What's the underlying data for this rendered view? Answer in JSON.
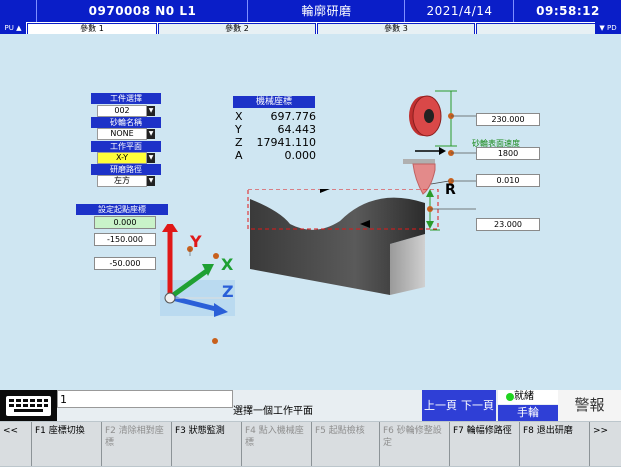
{
  "header": {
    "program": "0970008 N0 L1",
    "title": "輪廓研磨",
    "date": "2021/4/14",
    "time": "09:58:12"
  },
  "tabs": {
    "left_edge": "PU ▲",
    "right_edge": "▼ PD",
    "items": [
      "參數 1",
      "參數 2",
      "參數 3",
      ""
    ]
  },
  "panel": {
    "workpiece_select_label": "工件選擇",
    "workpiece_value": "002",
    "wheel_name_label": "砂輪名稱",
    "wheel_name_value": "NONE",
    "work_plane_label": "工作平面",
    "work_plane_value": "X-Y",
    "grind_path_label": "研磨路徑",
    "grind_path_value": "左方",
    "start_coord_label": "設定起點座標",
    "start_values": [
      "0.000",
      "-150.000",
      "-50.000"
    ]
  },
  "machine_coords": {
    "title": "機械座標",
    "axes": [
      {
        "axis": "X",
        "value": "697.776"
      },
      {
        "axis": "Y",
        "value": "64.443"
      },
      {
        "axis": "Z",
        "value": "17941.110"
      },
      {
        "axis": "A",
        "value": "0.000"
      }
    ]
  },
  "wheel_params": {
    "diameter": "230.000",
    "surface_speed_label": "砂輪表面速度",
    "surface_speed": "1800",
    "radius_value": "0.010",
    "radius_label": "R",
    "height_value": "23.000"
  },
  "axes_icon": {
    "y": "Y",
    "x": "X",
    "z": "Z"
  },
  "message_bar": {
    "input_value": "1",
    "prompt": "選擇一個工作平面",
    "prev_page": "上一頁",
    "next_page": "下一頁",
    "status": "就緒",
    "mode": "手輪",
    "alarm": "警報"
  },
  "function_keys": [
    {
      "label": "<<",
      "enabled": true
    },
    {
      "label": "F1 座標切換",
      "enabled": true
    },
    {
      "label": "F2 清除相對座標",
      "enabled": false
    },
    {
      "label": "F3 狀態監測",
      "enabled": true
    },
    {
      "label": "F4 點入機械座標",
      "enabled": false
    },
    {
      "label": "F5 起點檢核",
      "enabled": false
    },
    {
      "label": "F6 砂輪修整設定",
      "enabled": false
    },
    {
      "label": "F7 輪幅修路徑",
      "enabled": true
    },
    {
      "label": "F8 退出研磨",
      "enabled": true
    },
    {
      "label": ">>",
      "enabled": true
    }
  ],
  "colors": {
    "header_bg": "#0a1ec8",
    "screen_bg": "#cfe6f2",
    "accent_red": "#e01818",
    "accent_green": "#1fa033",
    "accent_yellow": "#ffff3a"
  }
}
